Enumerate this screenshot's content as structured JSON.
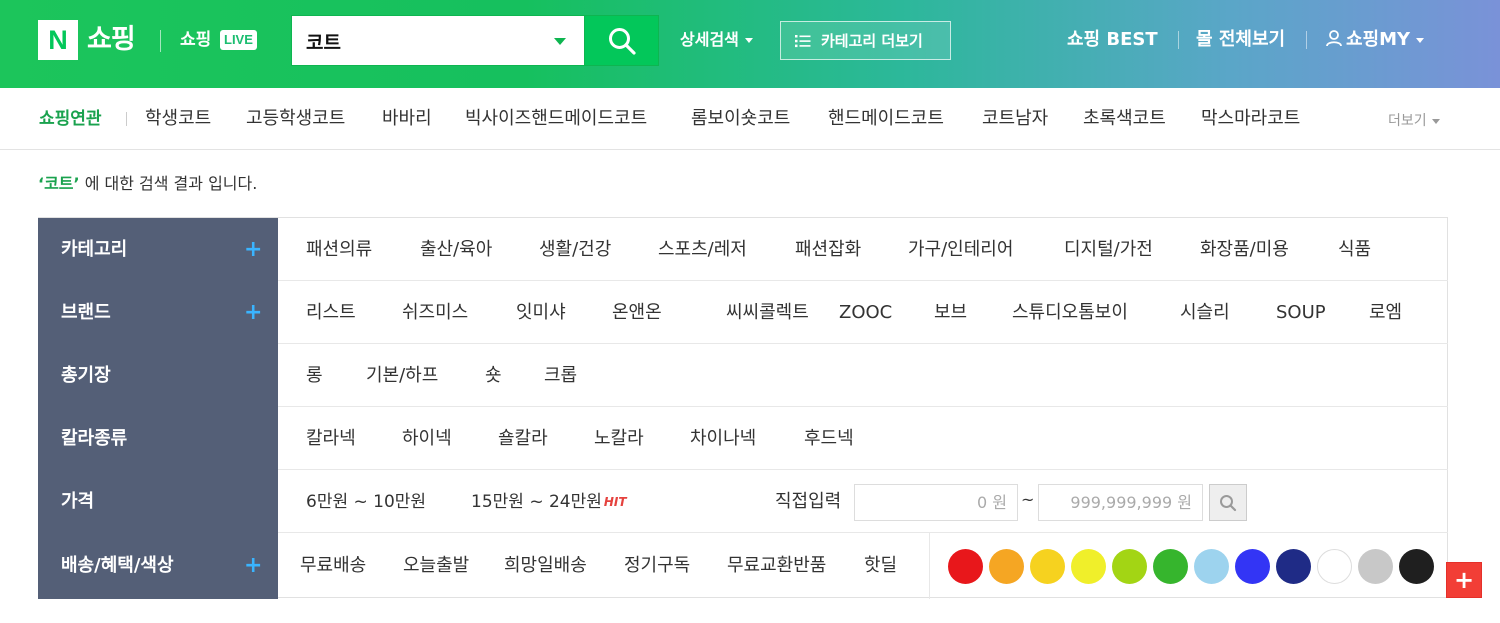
{
  "header": {
    "logo_letter": "N",
    "logo_text": "쇼핑",
    "live_text": "쇼핑",
    "live_badge": "LIVE",
    "search": {
      "value": "코트"
    },
    "detail_search": "상세검색",
    "category_more": "카테고리 더보기",
    "best": "쇼핑 BEST",
    "mall_all": "몰 전체보기",
    "my": "쇼핑MY"
  },
  "related": {
    "title": "쇼핑연관",
    "items": [
      "학생코트",
      "고등학생코트",
      "바바리",
      "빅사이즈핸드메이드코트",
      "롬보이숏코트",
      "핸드메이드코트",
      "코트남자",
      "초록색코트",
      "막스마라코트"
    ],
    "more": "더보기"
  },
  "result": {
    "keyword": "‘코트’",
    "suffix": " 에 대한 검색 결과 입니다."
  },
  "filters": {
    "category": {
      "label": "카테고리",
      "plus": "+",
      "options": [
        "패션의류",
        "출산/육아",
        "생활/건강",
        "스포츠/레저",
        "패션잡화",
        "가구/인테리어",
        "디지털/가전",
        "화장품/미용",
        "식품"
      ]
    },
    "brand": {
      "label": "브랜드",
      "plus": "+",
      "options": [
        "리스트",
        "쉬즈미스",
        "잇미샤",
        "온앤온",
        "씨씨콜렉트",
        "ZOOC",
        "보브",
        "스튜디오톰보이",
        "시슬리",
        "SOUP",
        "로엠"
      ]
    },
    "length": {
      "label": "총기장",
      "options": [
        "롱",
        "기본/하프",
        "숏",
        "크롭"
      ]
    },
    "collar": {
      "label": "칼라종류",
      "options": [
        "칼라넥",
        "하이넥",
        "숄칼라",
        "노칼라",
        "차이나넥",
        "후드넥"
      ]
    },
    "price": {
      "label": "가격",
      "options": [
        "6만원 ~ 10만원",
        "15만원 ~ 24만원"
      ],
      "hit": "HIT",
      "direct_label": "직접입력",
      "min_placeholder": "0 원",
      "tilde": "~",
      "max_placeholder": "999,999,999 원"
    },
    "delivery": {
      "label": "배송/혜택/색상",
      "plus": "+",
      "options": [
        "무료배송",
        "오늘출발",
        "희망일배송",
        "정기구독",
        "무료교환반품",
        "핫딜"
      ],
      "colors": [
        "#e8171b",
        "#f5a623",
        "#f6d21f",
        "#f0ef2a",
        "#a3d514",
        "#36b52d",
        "#9dd3ee",
        "#3335f5",
        "#1f2b86",
        "#ffffff",
        "#c8c8c8",
        "#1f1f1f"
      ]
    }
  },
  "fab": {
    "label": "+"
  }
}
